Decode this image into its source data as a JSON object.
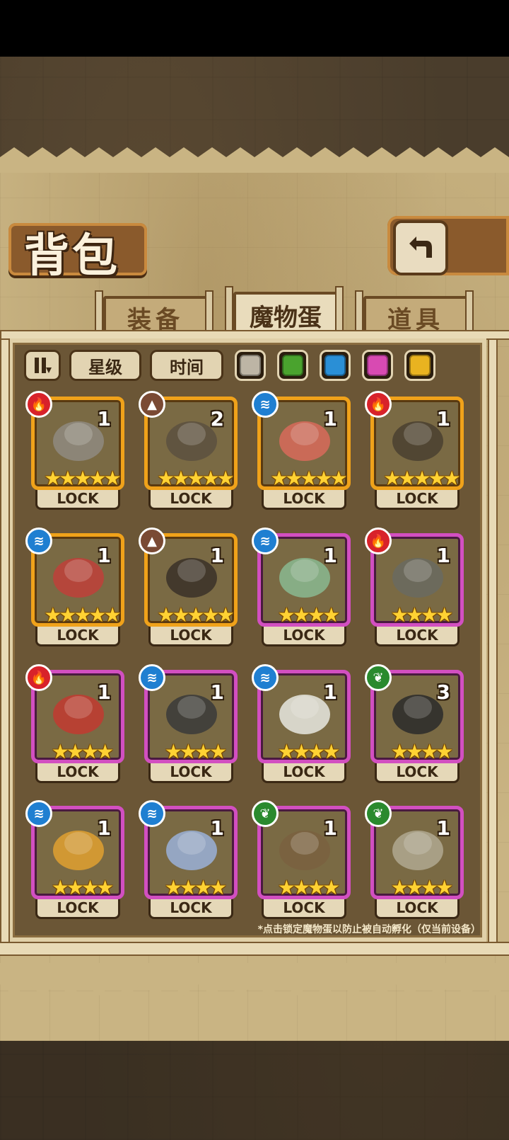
{
  "title": "背包",
  "back_icon": "back-arrow-icon",
  "tabs": [
    {
      "label": "装备",
      "active": false
    },
    {
      "label": "魔物蛋",
      "active": true
    },
    {
      "label": "道具",
      "active": false
    }
  ],
  "filters": {
    "sort_icon": "sort-toggle-icon",
    "star_label": "星级",
    "time_label": "时间",
    "rarity_colors": [
      "#bdb5a5",
      "#4aa32e",
      "#2a8fd6",
      "#d84ab2",
      "#e9b320"
    ]
  },
  "lock_label": "LOCK",
  "eggs": [
    {
      "element": "fire",
      "count": "1",
      "stars": "★★★★★",
      "rarity": "gold"
    },
    {
      "element": "earth",
      "count": "2",
      "stars": "★★★★★",
      "rarity": "gold"
    },
    {
      "element": "water",
      "count": "1",
      "stars": "★★★★★",
      "rarity": "gold"
    },
    {
      "element": "fire",
      "count": "1",
      "stars": "★★★★★",
      "rarity": "gold"
    },
    {
      "element": "water",
      "count": "1",
      "stars": "★★★★★",
      "rarity": "gold"
    },
    {
      "element": "earth",
      "count": "1",
      "stars": "★★★★★",
      "rarity": "gold"
    },
    {
      "element": "water",
      "count": "1",
      "stars": "★★★★",
      "rarity": "purple"
    },
    {
      "element": "fire",
      "count": "1",
      "stars": "★★★★",
      "rarity": "purple"
    },
    {
      "element": "fire",
      "count": "1",
      "stars": "★★★★",
      "rarity": "purple"
    },
    {
      "element": "water",
      "count": "1",
      "stars": "★★★★",
      "rarity": "purple"
    },
    {
      "element": "water",
      "count": "1",
      "stars": "★★★★",
      "rarity": "purple"
    },
    {
      "element": "wind",
      "count": "3",
      "stars": "★★★★",
      "rarity": "purple"
    },
    {
      "element": "water",
      "count": "1",
      "stars": "★★★★",
      "rarity": "purple"
    },
    {
      "element": "water",
      "count": "1",
      "stars": "★★★★",
      "rarity": "purple"
    },
    {
      "element": "wind",
      "count": "1",
      "stars": "★★★★",
      "rarity": "purple"
    },
    {
      "element": "wind",
      "count": "1",
      "stars": "★★★★",
      "rarity": "purple"
    }
  ],
  "footnote": "*点击锁定魔物蛋以防止被自动孵化（仅当前设备）"
}
